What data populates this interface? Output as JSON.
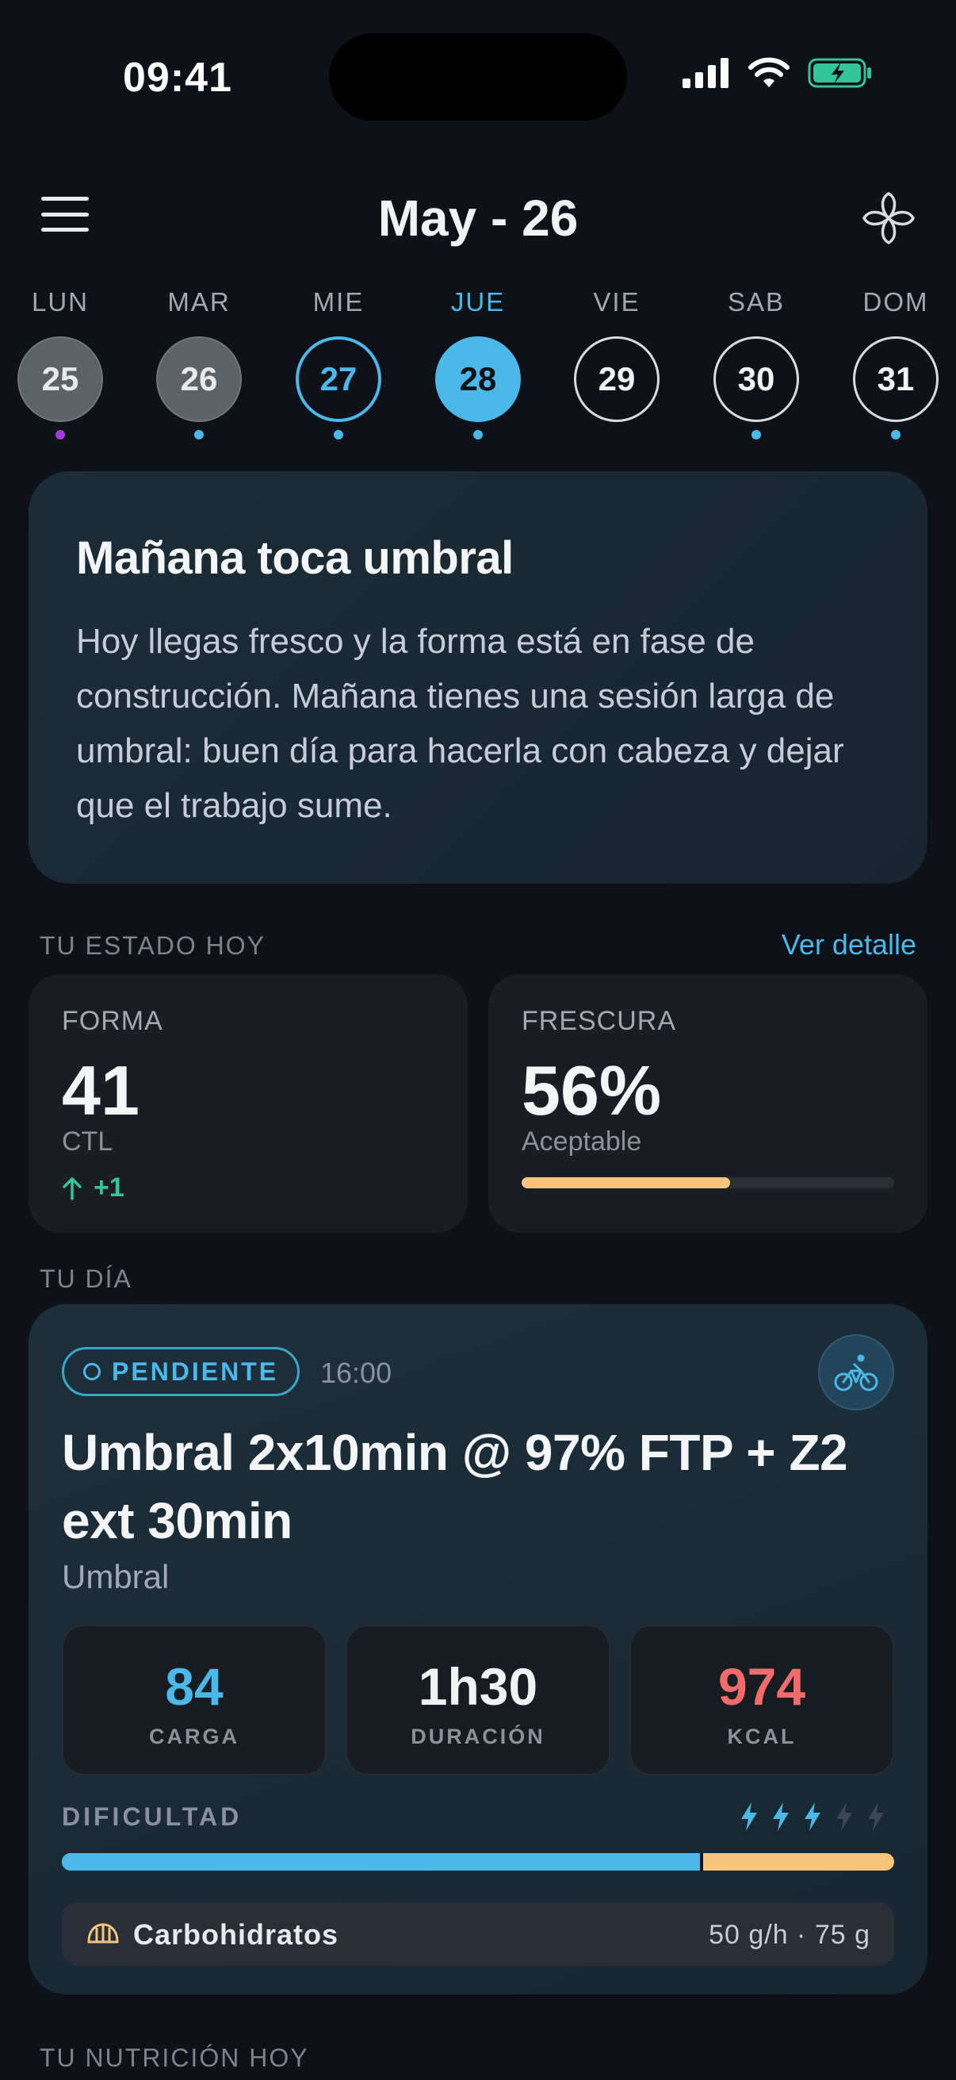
{
  "status_bar": {
    "time": "09:41"
  },
  "header": {
    "title": "May - 26"
  },
  "week": [
    {
      "label": "LUN",
      "day": "25",
      "state": "past",
      "dot": "#a23ad6"
    },
    {
      "label": "MAR",
      "day": "26",
      "state": "past",
      "dot": "#4ab8e8"
    },
    {
      "label": "MIE",
      "day": "27",
      "state": "ring",
      "dot": "#4ab8e8"
    },
    {
      "label": "JUE",
      "day": "28",
      "state": "selected",
      "dot": "#4ab8e8"
    },
    {
      "label": "VIE",
      "day": "29",
      "state": "future",
      "dot": ""
    },
    {
      "label": "SAB",
      "day": "30",
      "state": "future",
      "dot": "#4ab8e8"
    },
    {
      "label": "DOM",
      "day": "31",
      "state": "future",
      "dot": "#4ab8e8"
    }
  ],
  "insight": {
    "title": "Mañana toca umbral",
    "body": "Hoy llegas fresco y la forma está en fase de construcción. Mañana tienes una sesión larga de umbral: buen día para hacerla con cabeza y dejar que el trabajo sume."
  },
  "estado": {
    "section_title": "TU ESTADO HOY",
    "link": "Ver detalle",
    "forma": {
      "label": "FORMA",
      "value": "41",
      "sub": "CTL",
      "delta": "+1"
    },
    "frescura": {
      "label": "FRESCURA",
      "value": "56%",
      "sub": "Aceptable",
      "progress": 0.56
    }
  },
  "dia": {
    "section_title": "TU DÍA",
    "workout": {
      "status": "PENDIENTE",
      "time": "16:00",
      "icon": "bike-icon",
      "title": "Umbral 2x10min @ 97% FTP + Z2 ext 30min",
      "type": "Umbral",
      "metrics": [
        {
          "value": "84",
          "label": "CARGA",
          "color": "#4ab8e8"
        },
        {
          "value": "1h30",
          "label": "DURACIÓN",
          "color": "#f1f2f4"
        },
        {
          "value": "974",
          "label": "KCAL",
          "color": "#f26b6b"
        }
      ],
      "difficulty": {
        "label": "DIFICULTAD",
        "level": 3,
        "max": 5,
        "fill": 0.77
      },
      "carbs": {
        "label": "Carbohidratos",
        "value": "50 g/h · 75 g"
      }
    }
  },
  "nutricion": {
    "section_title": "TU NUTRICIÓN HOY"
  },
  "colors": {
    "accent": "#4ab8e8",
    "warning": "#f9c57d",
    "positive": "#34c49a",
    "danger": "#f26b6b"
  }
}
